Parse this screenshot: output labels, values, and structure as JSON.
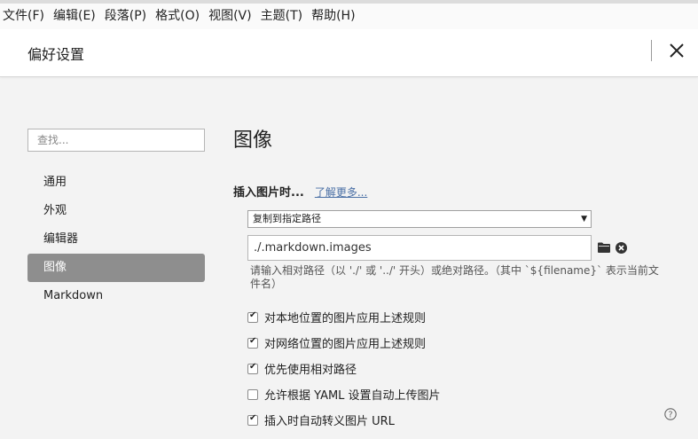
{
  "menu": [
    "文件(F)",
    "编辑(E)",
    "段落(P)",
    "格式(O)",
    "视图(V)",
    "主题(T)",
    "帮助(H)"
  ],
  "header": {
    "title": "偏好设置"
  },
  "sidebar": {
    "search_placeholder": "查找...",
    "items": [
      {
        "label": "通用",
        "active": false
      },
      {
        "label": "外观",
        "active": false
      },
      {
        "label": "编辑器",
        "active": false
      },
      {
        "label": "图像",
        "active": true
      },
      {
        "label": "Markdown",
        "active": false
      }
    ]
  },
  "main": {
    "heading": "图像",
    "insert_label": "插入图片时...",
    "learn_more": "了解更多...",
    "select_value": "复制到指定路径",
    "path_value": "./.markdown.images",
    "hint": "请输入相对路径（以 './' 或 '../' 开头）或绝对路径。（其中 `${filename}` 表示当前文件名）",
    "checkboxes": [
      {
        "label": "对本地位置的图片应用上述规则",
        "checked": true
      },
      {
        "label": "对网络位置的图片应用上述规则",
        "checked": true
      },
      {
        "label": "优先使用相对路径",
        "checked": true
      },
      {
        "label": "允许根据 YAML 设置自动上传图片",
        "checked": false
      },
      {
        "label": "插入时自动转义图片 URL",
        "checked": true
      }
    ]
  },
  "icons": {
    "close": "close-icon",
    "folder": "folder-icon",
    "clear": "clear-icon",
    "help": "help-icon",
    "dropdown": "chevron-down-icon"
  },
  "colors": {
    "active_nav_bg": "#8e8e8e",
    "link": "#4a6fa5",
    "window_bg": "#f3f3f3"
  }
}
